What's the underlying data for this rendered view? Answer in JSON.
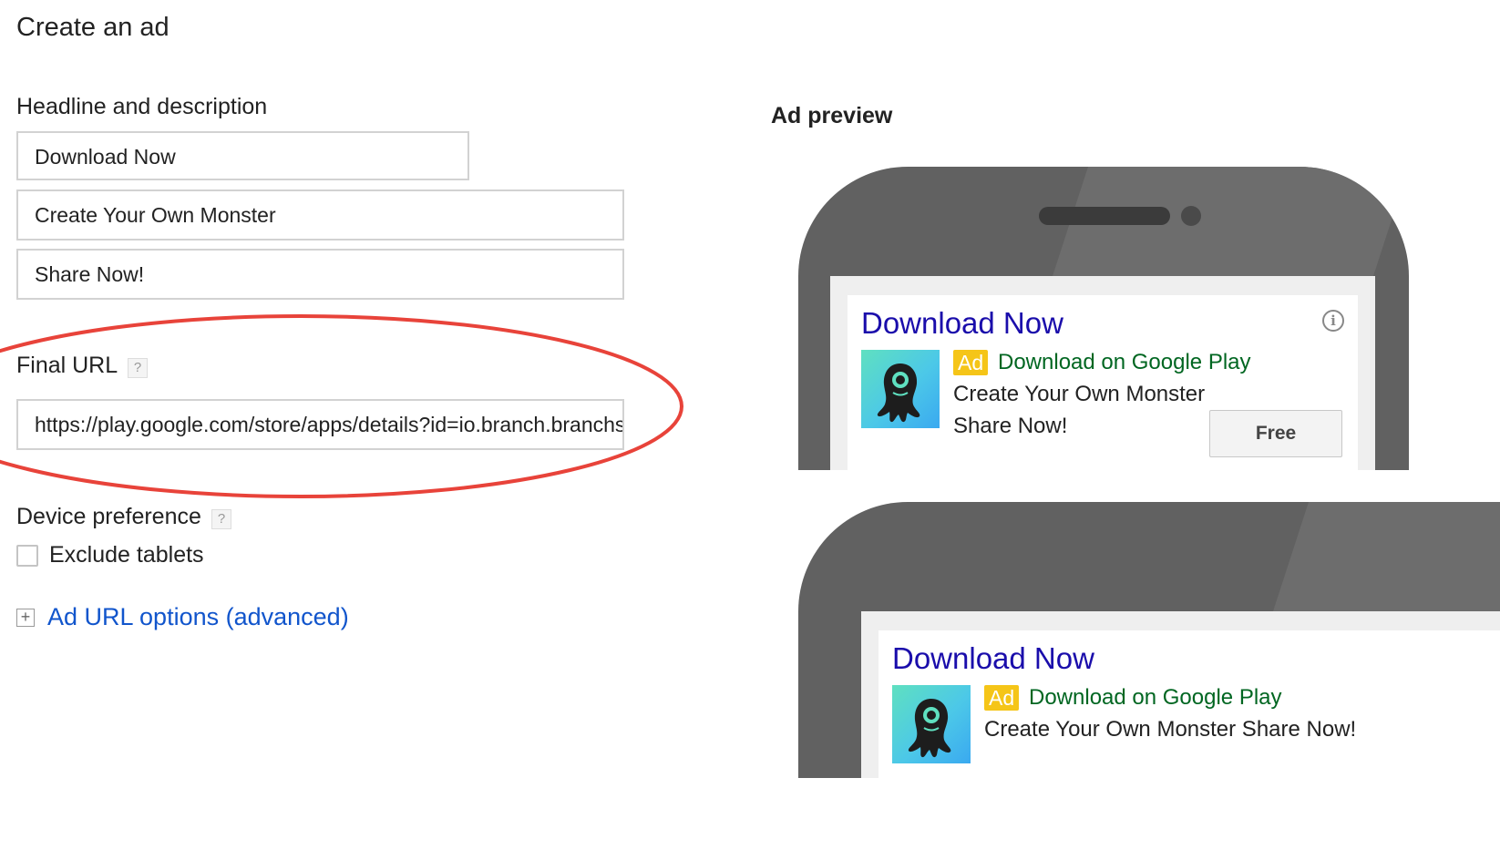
{
  "page": {
    "title": "Create an ad"
  },
  "form": {
    "headline_section_label": "Headline and description",
    "headline": "Download Now",
    "description_line_1": "Create Your Own Monster",
    "description_line_2": "Share Now!",
    "final_url_label": "Final URL",
    "final_url_value": "https://play.google.com/store/apps/details?id=io.branch.branchster",
    "help_glyph": "?",
    "device_preference_label": "Device preference",
    "exclude_tablets_label": "Exclude tablets",
    "exclude_tablets_checked": false,
    "expand_glyph": "+",
    "ad_url_options_link": "Ad URL options (advanced)"
  },
  "preview": {
    "title": "Ad preview",
    "ad_large": {
      "headline": "Download Now",
      "badge": "Ad",
      "display_text": "Download on Google Play",
      "description_line_1": "Create Your Own Monster",
      "description_line_2": "Share Now!",
      "install_button": "Free",
      "info_glyph": "i"
    },
    "ad_small": {
      "headline": "Download Now",
      "badge": "Ad",
      "display_text": "Download on Google Play",
      "description": "Create Your Own Monster Share Now!"
    }
  },
  "icons": {
    "help": "question-mark-icon",
    "expand": "plus-box-icon",
    "info": "info-circle-icon",
    "app": "monster-app-icon",
    "annotation": "red-ellipse-highlight"
  },
  "colors": {
    "link_blue": "#1155cc",
    "ad_headline_blue": "#1a0dab",
    "ad_url_green": "#006621",
    "ad_badge_yellow": "#f5c518",
    "phone_gray": "#616161",
    "highlight_red": "#e8433a"
  }
}
